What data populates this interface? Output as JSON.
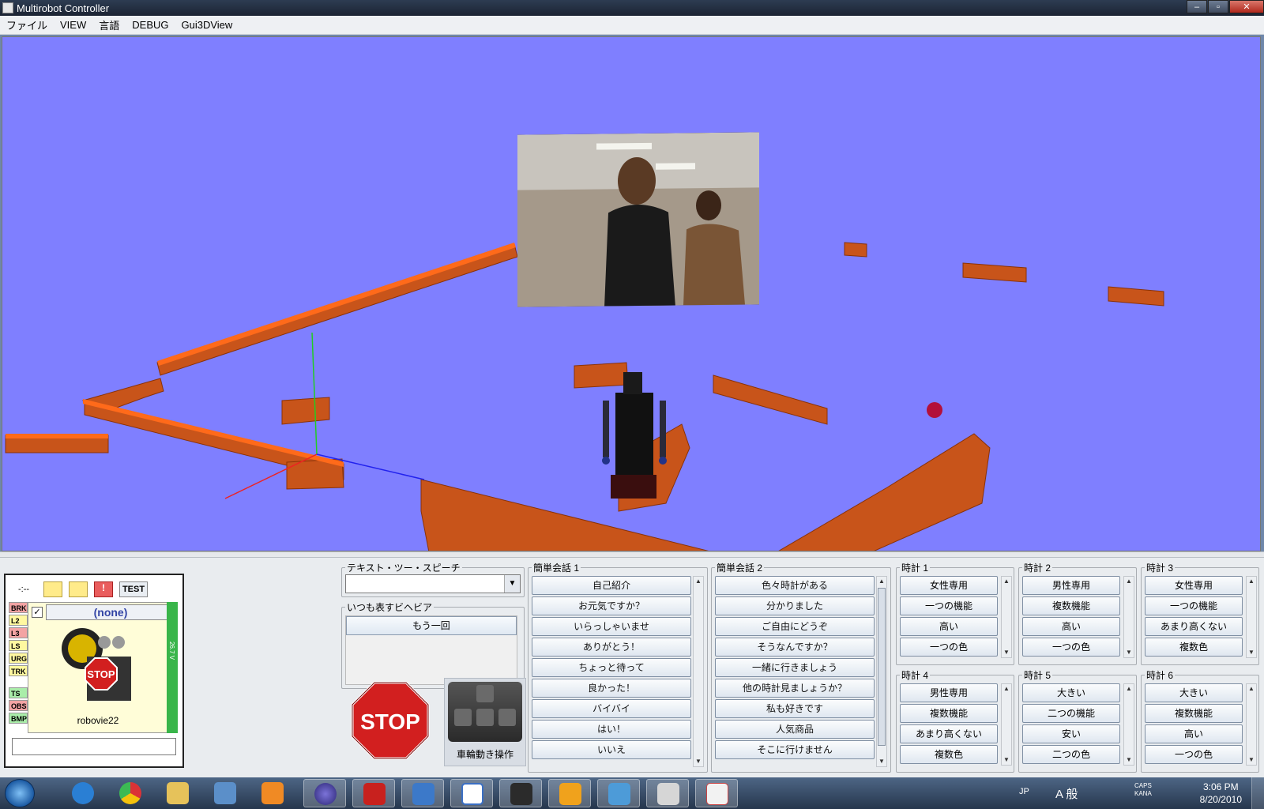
{
  "window": {
    "title": "Multirobot Controller",
    "minimize": "–",
    "maximize": "▫",
    "close": "✕"
  },
  "menu": [
    "ファイル",
    "VIEW",
    "言語",
    "DEBUG",
    "Gui3DView"
  ],
  "robot_panel": {
    "status_dots": "-:--",
    "test_label": "TEST",
    "selector_value": "(none)",
    "robot_name": "robovie22",
    "battery": "26.7 V",
    "sensors": [
      {
        "label": "BRK",
        "status": "red"
      },
      {
        "label": "L2",
        "status": "yellow"
      },
      {
        "label": "L3",
        "status": "red"
      },
      {
        "label": "LS",
        "status": "yellow"
      },
      {
        "label": "URG",
        "status": "yellow"
      },
      {
        "label": "TRK",
        "status": "yellow"
      },
      {
        "label": "TS",
        "status": "green"
      },
      {
        "label": "OBS",
        "status": "red"
      },
      {
        "label": "BMP",
        "status": "green"
      }
    ]
  },
  "tts": {
    "label": "テキスト・ツー・スピーチ",
    "value": ""
  },
  "repeat": {
    "label": "いつも表すビヘビア",
    "items": [
      "もう一回"
    ]
  },
  "stop_label": "STOP",
  "wheel_label": "車輪動き操作",
  "conversation1": {
    "label": "簡単会話 1",
    "items": [
      "自己紹介",
      "お元気ですか？",
      "いらっしゃいませ",
      "ありがとう！",
      "ちょっと待って",
      "良かった！",
      "バイバイ",
      "はい！",
      "いいえ"
    ]
  },
  "conversation2": {
    "label": "簡単会話 2",
    "items": [
      "色々時計がある",
      "分かりました",
      "ご自由にどうぞ",
      "そうなんですか？",
      "一緒に行きましょう",
      "他の時計見ましょうか？",
      "私も好きです",
      "人気商品",
      "そこに行けません"
    ]
  },
  "watches": [
    {
      "label": "時計 1",
      "items": [
        "女性専用",
        "一つの機能",
        "高い",
        "一つの色"
      ]
    },
    {
      "label": "時計 2",
      "items": [
        "男性専用",
        "複数機能",
        "高い",
        "一つの色"
      ]
    },
    {
      "label": "時計 3",
      "items": [
        "女性専用",
        "一つの機能",
        "あまり高くない",
        "複数色"
      ]
    },
    {
      "label": "時計 4",
      "items": [
        "男性専用",
        "複数機能",
        "あまり高くない",
        "複数色"
      ]
    },
    {
      "label": "時計 5",
      "items": [
        "大きい",
        "二つの機能",
        "安い",
        "二つの色"
      ]
    },
    {
      "label": "時計 6",
      "items": [
        "大きい",
        "複数機能",
        "高い",
        "一つの色"
      ]
    }
  ],
  "taskbar": {
    "apps": [
      "internet-explorer-icon",
      "chrome-icon",
      "explorer-icon",
      "pen-tool-icon",
      "media-player-icon",
      "eclipse-icon",
      "filezilla-icon",
      "remote-desktop-icon",
      "vnc-icon",
      "inkscape-icon",
      "robot-app-icon",
      "robot-app-2-icon",
      "paint-icon",
      "java-icon"
    ],
    "lang": "JP",
    "ime": "A 般",
    "caps": "CAPS",
    "kana": "KANA",
    "time": "3:06 PM",
    "date": "8/20/2010"
  },
  "colors": {
    "scene_bg": "#7f7fff",
    "wall": "#c8541a",
    "wall_top": "#ff6a1a",
    "ball": "#b3103a"
  }
}
